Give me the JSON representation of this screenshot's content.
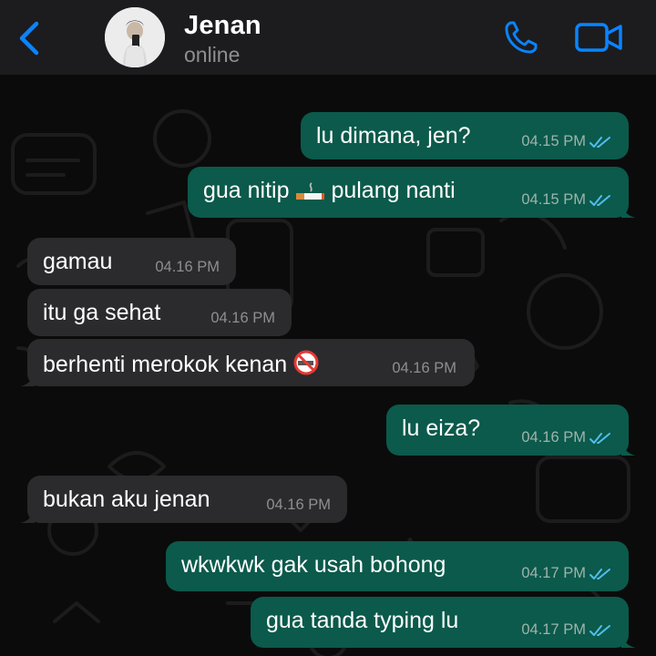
{
  "header": {
    "contact_name": "Jenan",
    "status": "online"
  },
  "colors": {
    "header_bg": "#1c1c1e",
    "accent": "#0a84ff",
    "outgoing_bubble": "#0b5a4b",
    "incoming_bubble": "#2b2b2d",
    "read_tick": "#53bdeb"
  },
  "icons": [
    "chevron-left-icon",
    "phone-icon",
    "video-camera-icon",
    "double-check-icon",
    "cigarette-emoji",
    "no-smoking-emoji"
  ],
  "messages": [
    {
      "direction": "outgoing",
      "text": "lu dimana, jen?",
      "time": "04.15 PM",
      "read": true
    },
    {
      "direction": "outgoing",
      "text_before": "gua nitip",
      "emoji": "cigarette",
      "text_after": "pulang nanti",
      "time": "04.15 PM",
      "read": true
    },
    {
      "direction": "incoming",
      "text": "gamau",
      "time": "04.16 PM"
    },
    {
      "direction": "incoming",
      "text": "itu ga sehat",
      "time": "04.16 PM"
    },
    {
      "direction": "incoming",
      "text": "berhenti merokok kenan",
      "emoji": "no-smoking",
      "time": "04.16 PM"
    },
    {
      "direction": "outgoing",
      "text": "lu eiza?",
      "time": "04.16 PM",
      "read": true
    },
    {
      "direction": "incoming",
      "text": "bukan aku jenan",
      "time": "04.16 PM"
    },
    {
      "direction": "outgoing",
      "text": "wkwkwk gak usah bohong",
      "time": "04.17 PM",
      "read": true
    },
    {
      "direction": "outgoing",
      "text": "gua tanda typing lu",
      "time": "04.17 PM",
      "read": true
    }
  ]
}
